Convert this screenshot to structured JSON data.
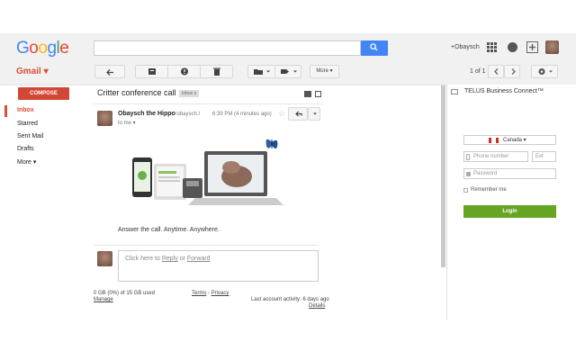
{
  "header": {
    "logo_letters": [
      {
        "ch": "G",
        "color": "#4285f4"
      },
      {
        "ch": "o",
        "color": "#ea4335"
      },
      {
        "ch": "o",
        "color": "#fbbc05"
      },
      {
        "ch": "g",
        "color": "#4285f4"
      },
      {
        "ch": "l",
        "color": "#34a853"
      },
      {
        "ch": "e",
        "color": "#ea4335"
      }
    ],
    "search_placeholder": "",
    "user_link": "+Obaysch"
  },
  "toolbar": {
    "app_label": "Gmail ▾",
    "more_label": "More ▾",
    "pagination": "1 of 1"
  },
  "sidebar": {
    "compose_label": "COMPOSE",
    "items": [
      {
        "label": "Inbox"
      },
      {
        "label": "Starred"
      },
      {
        "label": "Sent Mail"
      },
      {
        "label": "Drafts"
      },
      {
        "label": "More ▾"
      }
    ]
  },
  "message": {
    "subject": "Critter conference call",
    "label_tag": "Inbox  x",
    "sender_name": "Obaysch the Hippo",
    "sender_email": "<obaysch.l",
    "time": "6:39 PM (4 minutes ago)",
    "to": "to me ▾",
    "body_text": "Answer the call. Anytime. Anywhere.",
    "reply_prefix": "Click here to ",
    "reply_link": "Reply",
    "reply_or": " or ",
    "forward_link": "Forward"
  },
  "footer": {
    "storage": "0 GB (0%) of 15 GB used",
    "manage": "Manage",
    "terms": "Terms",
    "sep": " - ",
    "privacy": "Privacy",
    "activity": "Last account activity: 6 days ago",
    "details": "Details"
  },
  "telus": {
    "title": "TELUS Business Connect™",
    "country": "Canada ▾",
    "phone_placeholder": "Phone number",
    "ext_placeholder": "Ext",
    "password_placeholder": "Password",
    "remember": "Remember me",
    "login": "Login"
  },
  "colors": {
    "gmail_red": "#dd4b39",
    "compose_red": "#d14836",
    "search_blue": "#4285f4",
    "login_green": "#66a522"
  }
}
